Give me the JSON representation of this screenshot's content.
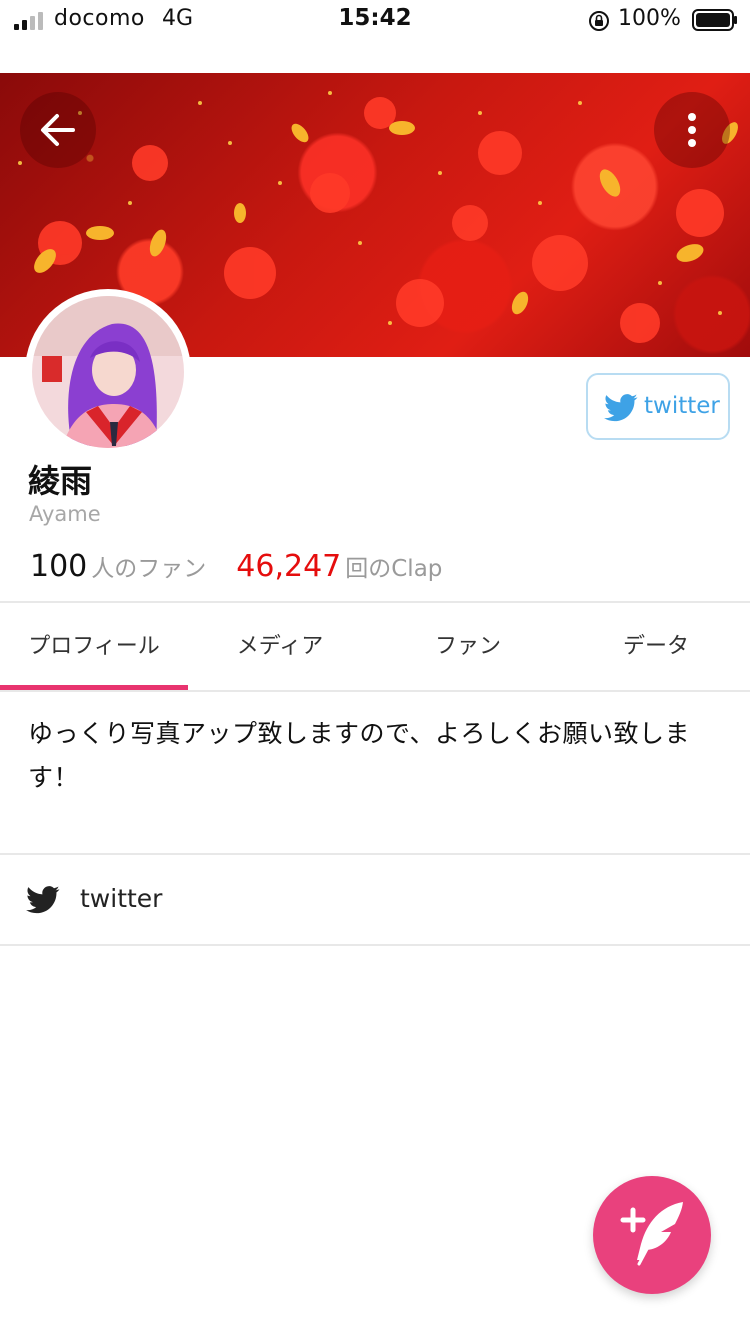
{
  "status_bar": {
    "carrier": "docomo",
    "network": "4G",
    "time": "15:42",
    "battery": "100%"
  },
  "profile": {
    "display_name": "綾雨",
    "user_id": "Ayame",
    "twitter_button_label": "twitter",
    "fans_count": "100",
    "fans_unit": "人のファン",
    "clap_count": "46,247",
    "clap_unit": "回のClap",
    "clap_color": "#e50d0d"
  },
  "tabs": [
    {
      "label": "プロフィール",
      "active": true
    },
    {
      "label": "メディア",
      "active": false
    },
    {
      "label": "ファン",
      "active": false
    },
    {
      "label": "データ",
      "active": false
    }
  ],
  "bio": "ゆっくり写真アップ致しますので、よろしくお願い致します！",
  "links": [
    {
      "label": "twitter",
      "icon": "twitter-icon"
    }
  ],
  "colors": {
    "accent": "#e8346f",
    "fab": "#e9417d",
    "twitter_blue": "#3ea2e6"
  },
  "icons": {
    "back": "arrow-left-icon",
    "more": "more-vertical-icon",
    "fab": "quill-plus-icon"
  }
}
